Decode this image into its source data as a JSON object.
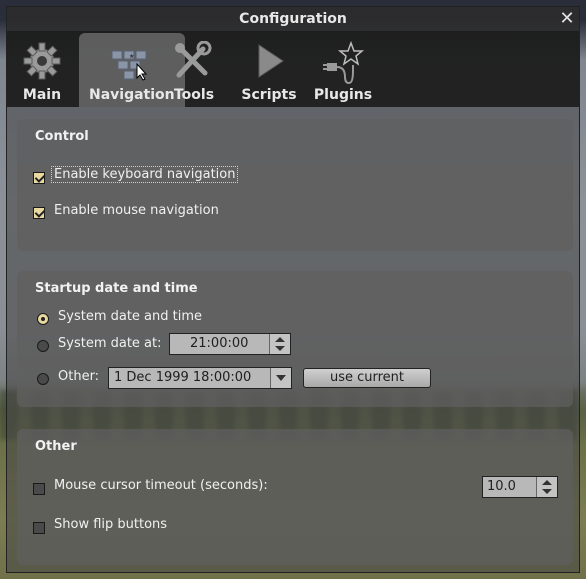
{
  "window": {
    "title": "Configuration"
  },
  "tabs": [
    {
      "label": "Main",
      "icon": "gear-icon"
    },
    {
      "label": "Navigation",
      "icon": "keyboard-icon"
    },
    {
      "label": "Tools",
      "icon": "wrench-screwdriver-icon"
    },
    {
      "label": "Scripts",
      "icon": "play-icon"
    },
    {
      "label": "Plugins",
      "icon": "plug-star-icon"
    }
  ],
  "active_tab": "Navigation",
  "control": {
    "title": "Control",
    "keyboard_nav": {
      "label": "Enable keyboard navigation",
      "checked": true
    },
    "mouse_nav": {
      "label": "Enable mouse navigation",
      "checked": true
    }
  },
  "startup": {
    "title": "Startup date and time",
    "system_date": {
      "label": "System date and time",
      "selected": true
    },
    "system_date_at": {
      "label": "System date at:",
      "value": "21:00:00",
      "selected": false
    },
    "other": {
      "label": "Other:",
      "value": "1 Dec 1999 18:00:00",
      "selected": false
    },
    "use_current_label": "use current"
  },
  "other": {
    "title": "Other",
    "cursor_timeout": {
      "label": "Mouse cursor timeout (seconds):",
      "checked": false,
      "value": "10.0"
    },
    "flip_buttons": {
      "label": "Show flip buttons",
      "checked": false
    }
  },
  "colors": {
    "check_fill": "#e9d9a0",
    "panel": "#5f5f5f",
    "tabbar": "#191919"
  }
}
